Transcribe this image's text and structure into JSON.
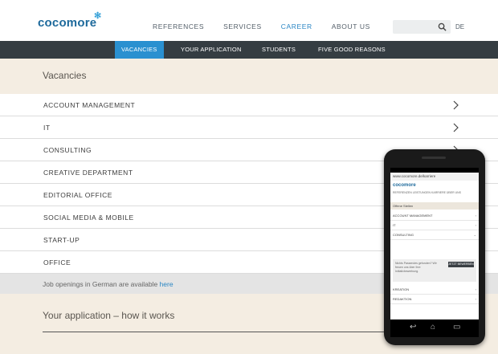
{
  "header": {
    "logo": "cocomore",
    "nav": [
      "REFERENCES",
      "SERVICES",
      "CAREER",
      "ABOUT US"
    ],
    "active_nav": "CAREER",
    "lang": "DE"
  },
  "subnav": [
    "VACANCIES",
    "YOUR APPLICATION",
    "STUDENTS",
    "FIVE GOOD REASONS"
  ],
  "vacancies": {
    "title": "Vacancies",
    "items": [
      "ACCOUNT MANAGEMENT",
      "IT",
      "CONSULTING",
      "CREATIVE DEPARTMENT",
      "EDITORIAL OFFICE",
      "SOCIAL MEDIA & MOBILE",
      "START-UP",
      "OFFICE"
    ]
  },
  "job_openings": {
    "text": "Job openings in German are available ",
    "link": "here"
  },
  "application": {
    "title": "Your application – how it works"
  },
  "phone": {
    "url": "www.cocomore.de/karriere",
    "logo": "cocomore",
    "nav": "REFERENZEN  LEISTUNGEN  KARRIERE  ÜBER UNS",
    "heading": "Offene Stellen",
    "rows_top": [
      "ACCOUNT MANAGEMENT",
      "IT",
      "CONSULTING"
    ],
    "box_text": "Nichts Passendes gefunden? Wir freuen uns über Ihre Initiativbewerbung.",
    "box_button": "JETZT BEWERBEN",
    "rows_bottom": [
      "KREATION",
      "REDAKTION"
    ]
  }
}
